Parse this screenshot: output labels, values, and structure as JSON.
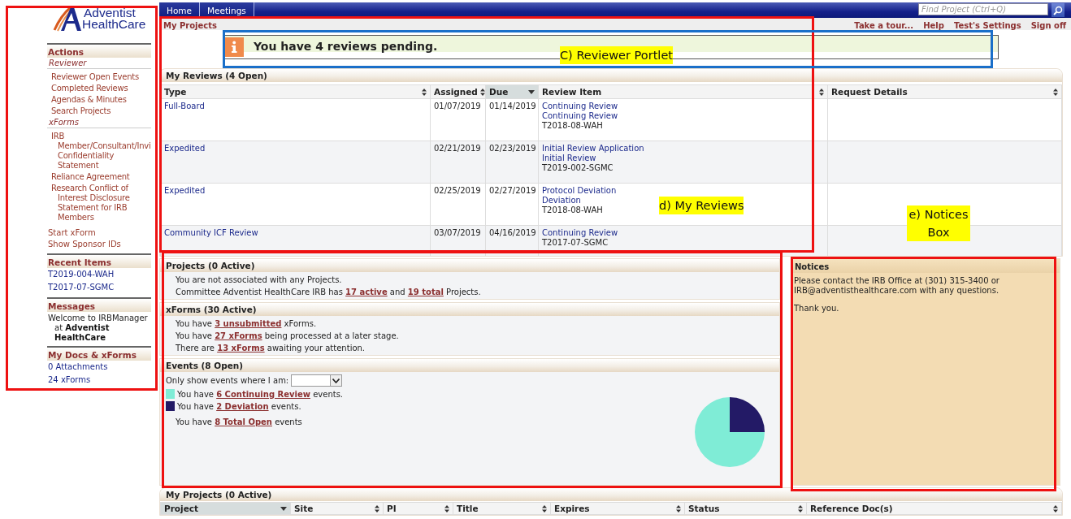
{
  "sidebar": {
    "logo": {
      "line1": "Adventist",
      "line2": "HealthCare"
    },
    "sections": [
      {
        "title": "Actions",
        "kind": "actions",
        "groups": [
          {
            "heading": "Reviewer",
            "items": [
              {
                "label": "Reviewer Open Events"
              },
              {
                "label": "Completed Reviews"
              },
              {
                "label": "Agendas & Minutes"
              },
              {
                "label": "Search Projects"
              }
            ]
          },
          {
            "heading": "xForms",
            "items": [
              {
                "label": "IRB Member/Consultant/Invi Confidentiality Statement"
              },
              {
                "label": "Reliance Agreement"
              },
              {
                "label": "Research Conflict of Interest Disclosure Statement for IRB Members"
              }
            ]
          }
        ],
        "items": [
          {
            "label": "Start xForm"
          },
          {
            "label": "Show Sponsor IDs"
          }
        ]
      },
      {
        "title": "Recent Items",
        "kind": "links",
        "items": [
          {
            "label": "T2019-004-WAH"
          },
          {
            "label": "T2017-07-SGMC"
          }
        ]
      },
      {
        "title": "Messages",
        "kind": "message",
        "message": "Welcome to IRBManager at **Adventist HealthCare**"
      },
      {
        "title": "My Docs & xForms",
        "kind": "links",
        "items": [
          {
            "label": "0 Attachments"
          },
          {
            "label": "24 xForms"
          }
        ]
      }
    ]
  },
  "nav": {
    "tabs": [
      {
        "label": "Home"
      },
      {
        "label": "Meetings"
      }
    ],
    "search": {
      "placeholder": "Find Project (Ctrl+Q)"
    }
  },
  "breadcrumb": "My Projects",
  "top_links": [
    "Take a tour...",
    "Help",
    "Test's Settings",
    "Sign off"
  ],
  "alert": {
    "text": "You have 4 reviews pending."
  },
  "my_reviews": {
    "title": "My Reviews (4 Open)",
    "columns": [
      {
        "label": "Type",
        "sorted": false
      },
      {
        "label": "Assigned",
        "sorted": false
      },
      {
        "label": "Due",
        "sorted": true
      },
      {
        "label": "Review Item",
        "sorted": false
      },
      {
        "label": "Request Details",
        "sorted": false
      }
    ],
    "rows": [
      {
        "type": "Full-Board",
        "assigned": "01/07/2019",
        "due": "01/14/2019",
        "review_links": [
          "Continuing Review",
          "Continuing Review"
        ],
        "project": "T2018-08-WAH"
      },
      {
        "type": "Expedited",
        "assigned": "02/21/2019",
        "due": "02/23/2019",
        "review_links": [
          "Initial Review Application",
          "Initial Review"
        ],
        "project": "T2019-002-SGMC"
      },
      {
        "type": "Expedited",
        "assigned": "02/25/2019",
        "due": "02/27/2019",
        "review_links": [
          "Protocol Deviation",
          "Deviation"
        ],
        "project": "T2018-08-WAH"
      },
      {
        "type": "Community ICF Review",
        "assigned": "03/07/2019",
        "due": "04/16/2019",
        "review_links": [
          "Continuing Review"
        ],
        "project": "T2017-07-SGMC"
      }
    ]
  },
  "projects": {
    "title": "Projects (0 Active)",
    "lines": [
      [
        {
          "text": "You are not associated with any Projects."
        }
      ],
      [
        {
          "text": "Committee Adventist HealthCare IRB has "
        },
        {
          "link": "17 active"
        },
        {
          "text": " and "
        },
        {
          "link": "19 total"
        },
        {
          "text": " Projects."
        }
      ]
    ]
  },
  "xforms": {
    "title": "xForms (30 Active)",
    "lines": [
      [
        {
          "text": "You have "
        },
        {
          "link": "3 unsubmitted"
        },
        {
          "text": " xForms."
        }
      ],
      [
        {
          "text": "You have "
        },
        {
          "link": "27 xForms"
        },
        {
          "text": " being processed at a later stage."
        }
      ],
      [
        {
          "text": "There are "
        },
        {
          "link": "13 xForms"
        },
        {
          "text": " awaiting your attention."
        }
      ]
    ]
  },
  "events": {
    "title": "Events (8 Open)",
    "filter_label": "Only show events where I am:",
    "legend": [
      {
        "color": "#7fecd6",
        "prefix": "You have ",
        "suffix": " events."
      },
      {
        "color": "#231a66",
        "prefix": "You have ",
        "suffix": " events."
      }
    ],
    "total": [
      {
        "text": "You have "
      },
      {
        "link": "8 Total Open"
      },
      {
        "text": " events"
      }
    ],
    "chart_data": {
      "type": "pie",
      "categories": [
        "6 Continuing Review",
        "2 Deviation"
      ],
      "values": [
        75,
        25
      ]
    }
  },
  "notices": {
    "title": "Notices",
    "paragraphs": [
      "Please contact the IRB Office at (301) 315-3400 or IRB@adventisthealthcare.com with any questions.",
      "Thank you."
    ]
  },
  "my_projects": {
    "title": "My Projects (0 Active)",
    "columns": [
      {
        "label": "Project",
        "sorted": true
      },
      {
        "label": "Site",
        "sorted": false
      },
      {
        "label": "PI",
        "sorted": false
      },
      {
        "label": "Title",
        "sorted": false
      },
      {
        "label": "Expires",
        "sorted": false
      },
      {
        "label": "Status",
        "sorted": false
      },
      {
        "label": "Reference Doc(s)",
        "sorted": false
      }
    ]
  },
  "annotations": [
    {
      "text": "C) Reviewer Portlet"
    },
    {
      "text": "d) My Reviews"
    },
    {
      "text": "e) Notices Box"
    }
  ]
}
